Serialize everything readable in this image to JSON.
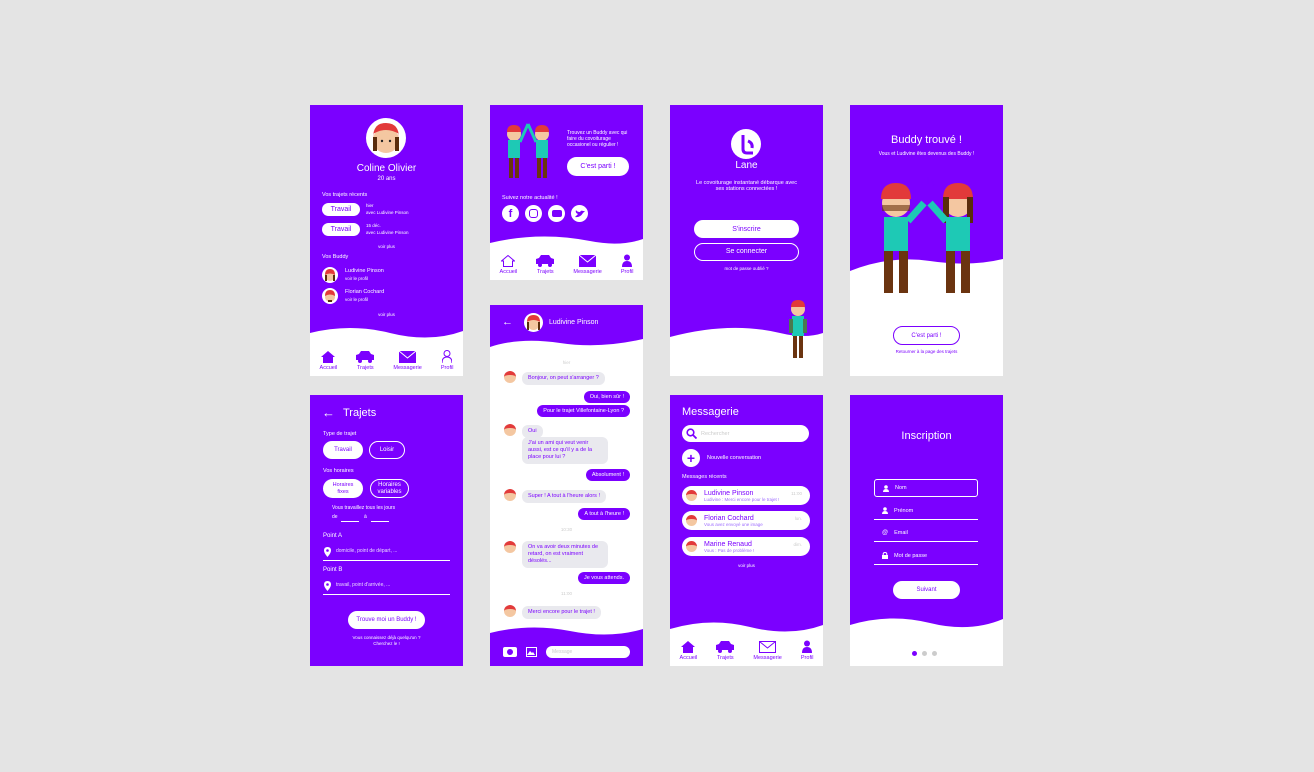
{
  "profile": {
    "name": "Coline Olivier",
    "age": "20 ans",
    "recent_trips_label": "Vos trajets récents",
    "trips": [
      {
        "tag": "Travail",
        "date": "hier",
        "with": "avec Ludivine Pinson"
      },
      {
        "tag": "Travail",
        "date": "15 déc.",
        "with": "avec Ludivine Pinson"
      }
    ],
    "see_more": "voir plus",
    "buddies_label": "Vos Buddy",
    "buddies": [
      {
        "name": "Ludivine Pinson",
        "link": "voir le profil"
      },
      {
        "name": "Florian Cochard",
        "link": "voir le profil"
      }
    ],
    "see_more_2": "voir plus"
  },
  "nav": {
    "home": "Accueil",
    "trips": "Trajets",
    "messages": "Messagerie",
    "profile": "Profil"
  },
  "home": {
    "promo": "Trouvez un Buddy avec qui faire du covoiturage occasionel ou régulier !",
    "cta": "C'est parti !",
    "follow": "Suivez notre actualité !"
  },
  "landing": {
    "brand": "Lane",
    "tagline": "Le covoiturage instantané débarque avec ses stations connectées !",
    "signup": "S'inscrire",
    "login": "Se connecter",
    "forgot": "mot de passe oublié ?"
  },
  "found": {
    "title": "Buddy trouvé !",
    "subtitle": "Vous et Ludivine êtes devenus des Buddy !",
    "cta": "C'est parti !",
    "back": "Retourner à la page des trajets"
  },
  "chat": {
    "contact": "Ludivine Pinson",
    "date_1": "hier",
    "date_2": "10:30",
    "date_3": "11:00",
    "messages": [
      {
        "side": "left",
        "text": "Bonjour, on peut s'arranger ?"
      },
      {
        "side": "right",
        "text": "Oui, bien sûr !"
      },
      {
        "side": "right",
        "text": "Pour le trajet Villefontaine-Lyon ?"
      },
      {
        "side": "left",
        "text": "Oui"
      },
      {
        "side": "left",
        "text": "J'ai un ami qui veut venir aussi, est ce qu'il y a de la place pour lui ?"
      },
      {
        "side": "right",
        "text": "Absolument !"
      },
      {
        "side": "left",
        "text": "Super ! A tout à l'heure alors !"
      },
      {
        "side": "right",
        "text": "A tout à l'heure !"
      },
      {
        "side": "left",
        "text": "On va avoir deux minutes de retard, on est vraiment désolés..."
      },
      {
        "side": "right",
        "text": "Je vous attends."
      },
      {
        "side": "left",
        "text": "Merci encore pour le trajet !"
      }
    ],
    "input_placeholder": "Message"
  },
  "trips_form": {
    "title": "Trajets",
    "type_label": "Type de trajet",
    "type_work": "Travail",
    "type_leisure": "Loisir",
    "hours_label": "Vos horaires",
    "hours_fixed": "Horaires fixes",
    "hours_variable": "Horaires variables",
    "daily_text": "Vous travaillez tous les jours",
    "from": "de",
    "to": "à",
    "point_a": "Point A",
    "point_a_placeholder": "domicile, point de départ, ...",
    "point_b": "Point B",
    "point_b_placeholder": "travail, point d'arrivée, ...",
    "cta": "Trouve moi un Buddy !",
    "footer_1": "Vous connaissez déjà quelqu'un ?",
    "footer_2": "Cherchez le !"
  },
  "messaging": {
    "title": "Messagerie",
    "search_placeholder": "Rechercher",
    "new_conv": "Nouvelle conversation",
    "recent_label": "Messages récents",
    "conversations": [
      {
        "name": "Ludivine Pinson",
        "preview": "Ludivine : Merci encore pour le trajet !",
        "time": "11:00"
      },
      {
        "name": "Florian Cochard",
        "preview": "Vous avez envoyé une image",
        "time": "lun."
      },
      {
        "name": "Marine Renaud",
        "preview": "Vous : Pas de problème !",
        "time": "dim."
      }
    ],
    "see_more": "voir plus"
  },
  "signup": {
    "title": "Inscription",
    "fields": [
      "Nom",
      "Prénom",
      "Email",
      "Mot de passe"
    ],
    "next": "Suivant"
  },
  "colors": {
    "brand": "#7b00ff",
    "background": "#e4e4e4",
    "bubble": "#e9e9ee"
  }
}
